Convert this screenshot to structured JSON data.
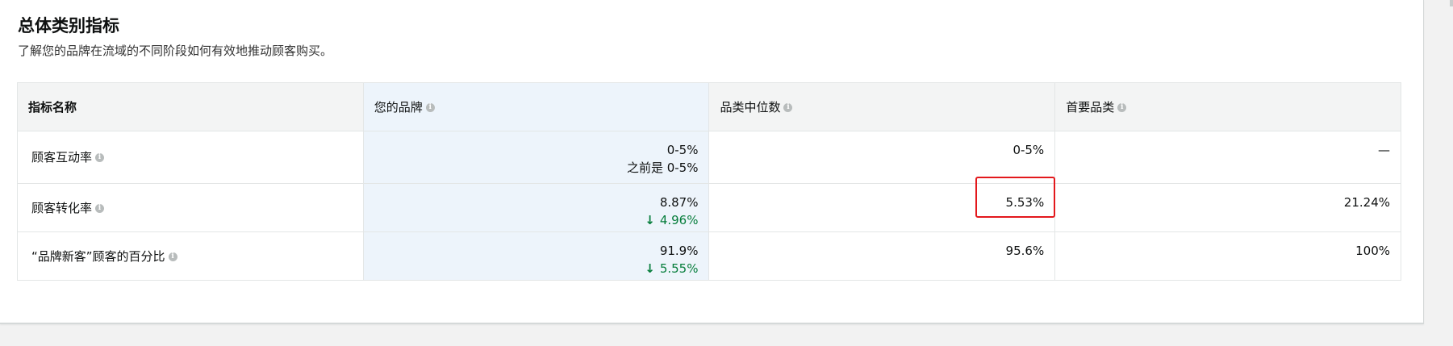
{
  "section": {
    "title": "总体类别指标",
    "subtitle": "了解您的品牌在流域的不同阶段如何有效地推动顾客购买。"
  },
  "table": {
    "headers": {
      "metric_name": "指标名称",
      "your_brand": "您的品牌",
      "category_median": "品类中位数",
      "top_category": "首要品类"
    },
    "rows": [
      {
        "name": "顾客互动率",
        "your_brand": "0-5%",
        "your_brand_sub": "之前是 0-5%",
        "category_median": "0-5%",
        "top_category": "—"
      },
      {
        "name": "顾客转化率",
        "your_brand": "8.87%",
        "your_brand_delta": "4.96%",
        "category_median": "5.53%",
        "top_category": "21.24%"
      },
      {
        "name": "“品牌新客”顾客的百分比",
        "your_brand": "91.9%",
        "your_brand_delta": "5.55%",
        "category_median": "95.6%",
        "top_category": "100%"
      }
    ]
  },
  "icons": {
    "info": "info-icon",
    "trend_down": "arrow-down-icon"
  },
  "colors": {
    "positive_delta": "#067d3b",
    "highlight_box": "#e3181c",
    "brand_column_bg": "#edf4fb"
  }
}
